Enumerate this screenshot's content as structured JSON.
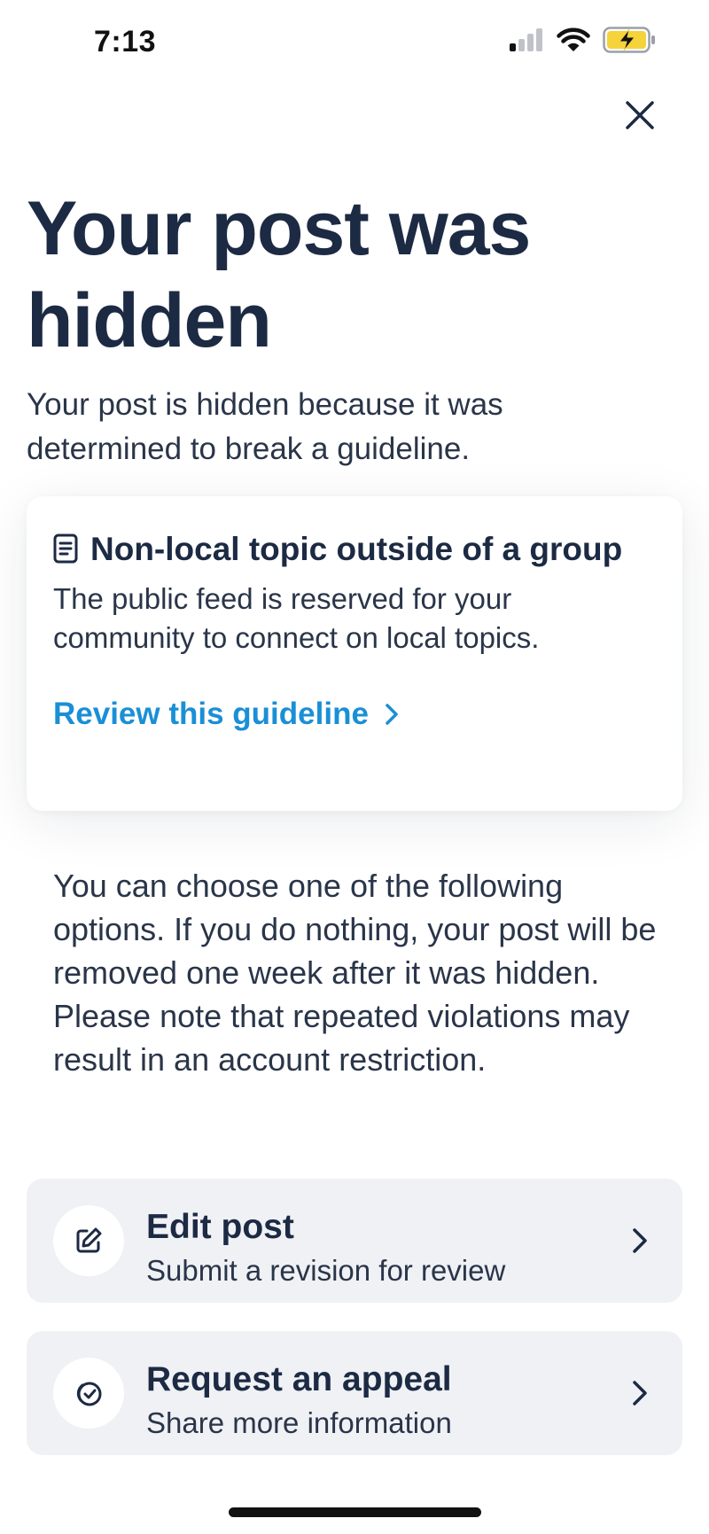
{
  "status_bar": {
    "time": "7:13",
    "icons": [
      "cellular-signal-icon",
      "wifi-icon",
      "battery-charging-icon"
    ],
    "battery_color": "#f5d33b"
  },
  "close_icon": "close-icon",
  "title": "Your post was hidden",
  "intro": "Your post is hidden because it was determined to break a guideline.",
  "guideline": {
    "icon": "document-icon",
    "heading": "Non-local topic outside of a group",
    "body": "The public feed is reserved for your community to connect on local topics.",
    "link_label": "Review this guideline",
    "link_color": "#1a8fd6"
  },
  "options_text": "You can choose one of the following options. If you do nothing, your post will be removed one week after it was hidden. Please note that repeated violations may result in an account restriction.",
  "options": [
    {
      "title": "Edit post",
      "subtitle": "Submit a revision for review",
      "icon": "edit-icon"
    },
    {
      "title": "Request an appeal",
      "subtitle": "Share more information",
      "icon": "check-badge-icon"
    }
  ],
  "colors": {
    "text_primary": "#1c2a43",
    "card_background": "#eff1f5",
    "accent_link": "#1a8fd6"
  }
}
